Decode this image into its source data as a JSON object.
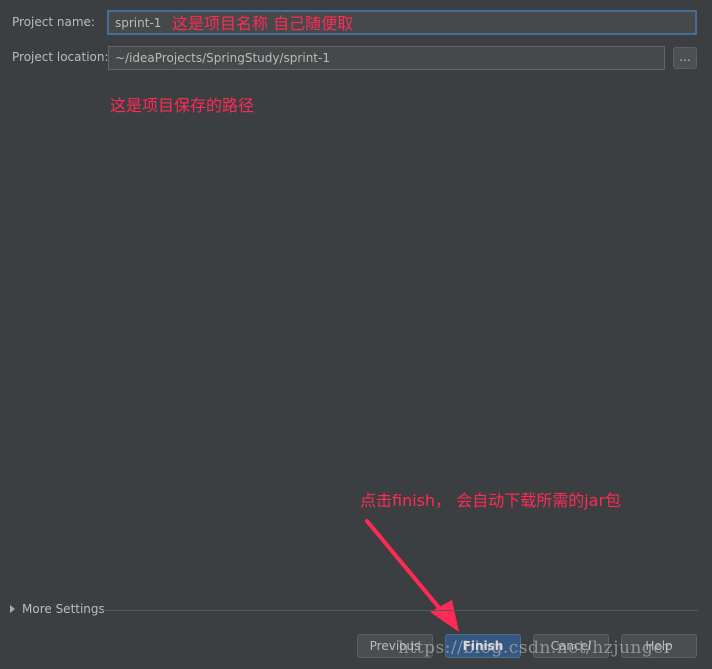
{
  "form": {
    "project_name_label": "Project name:",
    "project_name_value": "sprint-1",
    "project_location_label": "Project location:",
    "project_location_value": "~/ideaProjects/SpringStudy/sprint-1",
    "browse_label": "..."
  },
  "annotations": {
    "name_note": "这是项目名称 自己随便取",
    "path_note": "这是项目保存的路径",
    "finish_note": "点击finish， 会自动下载所需的jar包"
  },
  "more_settings": {
    "label": "More Settings"
  },
  "buttons": {
    "previous": "Previous",
    "finish": "Finish",
    "cancel": "Cancel",
    "help": "Help"
  },
  "watermark": "https://blog.csdn.net/hzjunger",
  "colors": {
    "annotation": "#ff2a55",
    "background": "#3c3f41",
    "default_button": "#365880"
  }
}
